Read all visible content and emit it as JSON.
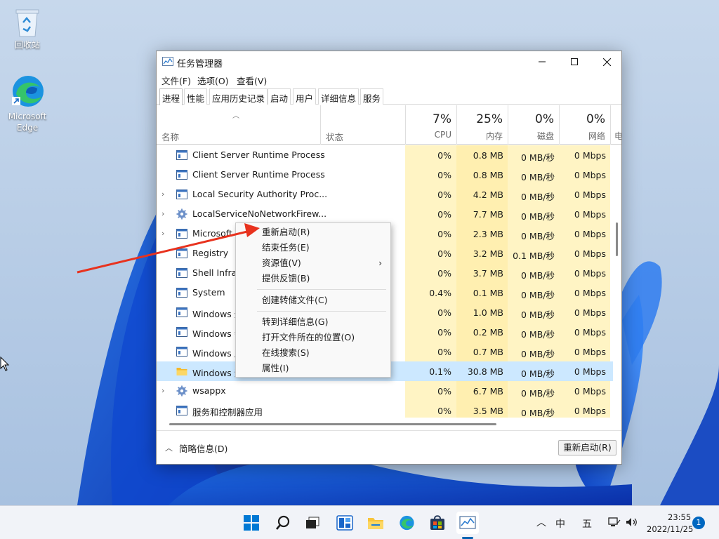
{
  "desktop": {
    "icons": [
      {
        "label": "回收站"
      },
      {
        "label": "Microsoft Edge"
      }
    ]
  },
  "window": {
    "title": "任务管理器",
    "menu": [
      "文件(F)",
      "选项(O)",
      "查看(V)"
    ],
    "tabs": [
      "进程",
      "性能",
      "应用历史记录",
      "启动",
      "用户",
      "详细信息",
      "服务"
    ],
    "active_tab": "进程"
  },
  "columns": {
    "name": "名称",
    "status": "状态",
    "cpu": {
      "pct": "7%",
      "label": "CPU"
    },
    "memory": {
      "pct": "25%",
      "label": "内存"
    },
    "disk": {
      "pct": "0%",
      "label": "磁盘"
    },
    "network": {
      "pct": "0%",
      "label": "网络"
    },
    "power": {
      "label": "电"
    }
  },
  "processes": [
    {
      "name": "Client Server Runtime Process",
      "cpu": "0%",
      "mem": "0.8 MB",
      "disk": "0 MB/秒",
      "net": "0 Mbps",
      "expand": false,
      "icon": "app-window-icon"
    },
    {
      "name": "Client Server Runtime Process",
      "cpu": "0%",
      "mem": "0.8 MB",
      "disk": "0 MB/秒",
      "net": "0 Mbps",
      "expand": false,
      "icon": "app-window-icon"
    },
    {
      "name": "Local Security Authority Proc...",
      "cpu": "0%",
      "mem": "4.2 MB",
      "disk": "0 MB/秒",
      "net": "0 Mbps",
      "expand": true,
      "icon": "app-window-icon"
    },
    {
      "name": "LocalServiceNoNetworkFirew...",
      "cpu": "0%",
      "mem": "7.7 MB",
      "disk": "0 MB/秒",
      "net": "0 Mbps",
      "expand": true,
      "icon": "gear-icon"
    },
    {
      "name": "Microsoft",
      "cpu": "0%",
      "mem": "2.3 MB",
      "disk": "0 MB/秒",
      "net": "0 Mbps",
      "expand": true,
      "icon": "app-window-icon"
    },
    {
      "name": "Registry",
      "cpu": "0%",
      "mem": "3.2 MB",
      "disk": "0.1 MB/秒",
      "net": "0 Mbps",
      "expand": false,
      "icon": "app-window-icon"
    },
    {
      "name": "Shell Infras",
      "cpu": "0%",
      "mem": "3.7 MB",
      "disk": "0 MB/秒",
      "net": "0 Mbps",
      "expand": false,
      "icon": "app-window-icon"
    },
    {
      "name": "System",
      "cpu": "0.4%",
      "mem": "0.1 MB",
      "disk": "0 MB/秒",
      "net": "0 Mbps",
      "expand": false,
      "icon": "app-window-icon"
    },
    {
      "name": "Windows 登",
      "cpu": "0%",
      "mem": "1.0 MB",
      "disk": "0 MB/秒",
      "net": "0 Mbps",
      "expand": false,
      "icon": "app-window-icon"
    },
    {
      "name": "Windows 会",
      "cpu": "0%",
      "mem": "0.2 MB",
      "disk": "0 MB/秒",
      "net": "0 Mbps",
      "expand": false,
      "icon": "app-window-icon"
    },
    {
      "name": "Windows 启",
      "cpu": "0%",
      "mem": "0.7 MB",
      "disk": "0 MB/秒",
      "net": "0 Mbps",
      "expand": false,
      "icon": "app-window-icon"
    },
    {
      "name": "Windows 资源管理器",
      "cpu": "0.1%",
      "mem": "30.8 MB",
      "disk": "0 MB/秒",
      "net": "0 Mbps",
      "expand": false,
      "icon": "folder-icon",
      "selected": true
    },
    {
      "name": "wsappx",
      "cpu": "0%",
      "mem": "6.7 MB",
      "disk": "0 MB/秒",
      "net": "0 Mbps",
      "expand": true,
      "icon": "gear-icon"
    },
    {
      "name": "服务和控制器应用",
      "cpu": "0%",
      "mem": "3.5 MB",
      "disk": "0 MB/秒",
      "net": "0 Mbps",
      "expand": false,
      "icon": "app-window-icon"
    }
  ],
  "footer": {
    "fewer_details": "简略信息(D)",
    "action_button": "重新启动(R)"
  },
  "context_menu": {
    "items": [
      "重新启动(R)",
      "结束任务(E)",
      "资源值(V)",
      "提供反馈(B)",
      "创建转储文件(C)",
      "转到详细信息(G)",
      "打开文件所在的位置(O)",
      "在线搜索(S)",
      "属性(I)"
    ]
  },
  "taskbar": {
    "tray": {
      "lang": "中",
      "ime": "五"
    },
    "time": "23:55",
    "date": "2022/11/25",
    "notification_count": "1"
  },
  "colors": {
    "cpu_heat": "#fff4c4",
    "mem_heat": "#ffefb0",
    "selected_row": "#cce8ff",
    "accent": "#0067c0",
    "arrow": "#e8321e"
  }
}
